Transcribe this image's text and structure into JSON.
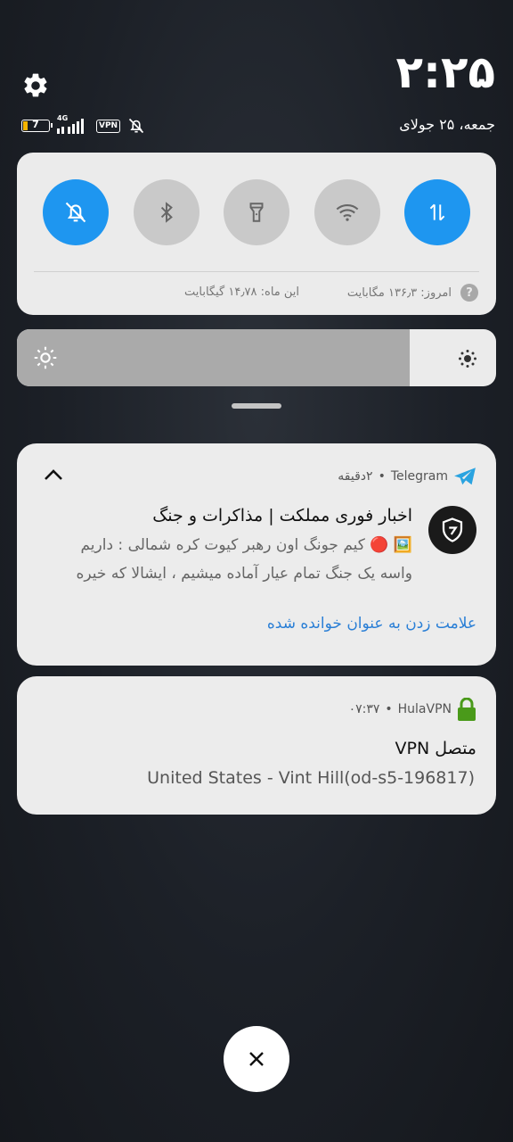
{
  "status": {
    "time": "۲:۲۵",
    "date": "جمعه، ۲۵ جولای",
    "battery_level": "7",
    "network_type": "4G",
    "vpn_badge": "VPN"
  },
  "quick_settings": {
    "tiles": [
      {
        "name": "silent-mode",
        "state": "on"
      },
      {
        "name": "bluetooth",
        "state": "off"
      },
      {
        "name": "flashlight",
        "state": "off"
      },
      {
        "name": "wifi",
        "state": "off"
      },
      {
        "name": "mobile-data",
        "state": "on"
      }
    ],
    "data_usage_today": "امروز: ۱۳۶٫۳ مگابایت",
    "data_usage_month": "این ماه: ۱۴٫۷۸ گیگابایت",
    "help": "?"
  },
  "brightness": {
    "level": 0.82
  },
  "notifications": [
    {
      "app": "Telegram",
      "time": "۲دقیقه",
      "title": "اخبار فوری مملکت | مذاکرات و جنگ",
      "body_line1": "🖼️ 🔴 کیم جونگ اون رهبر کیوت کره شمالی : داریم",
      "body_line2": "واسه یک جنگ تمام عیار آماده میشیم ، ایشالا که خیره",
      "action": "علامت زدن به عنوان خوانده شده"
    },
    {
      "app": "HulaVPN",
      "time": "۰۷:۳۷",
      "title": "متصل VPN",
      "body": "United States - Vint Hill(od-s5-196817)"
    }
  ],
  "colors": {
    "accent": "#1e96f0",
    "tile_off": "#c9c9c9",
    "card_bg": "#ebebeb",
    "telegram": "#2aa3e0",
    "vpn_lock": "#4a9a1a",
    "link": "#2a7fd6"
  },
  "separator": "•"
}
